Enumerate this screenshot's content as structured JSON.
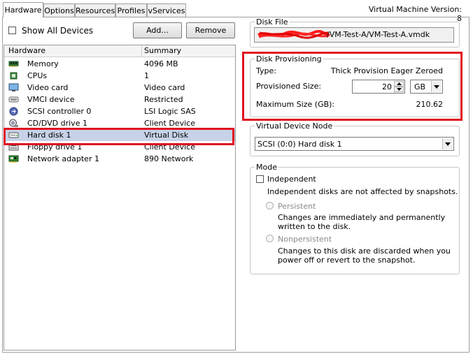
{
  "tabs": [
    {
      "label": "Hardware",
      "active": true
    },
    {
      "label": "Options",
      "active": false
    },
    {
      "label": "Resources",
      "active": false
    },
    {
      "label": "Profiles",
      "active": false
    },
    {
      "label": "vServices",
      "active": false
    }
  ],
  "vm_version": "Virtual Machine Version: 8",
  "toolbar": {
    "show_all_devices": "Show All Devices",
    "add_button": "Add...",
    "remove_button": "Remove"
  },
  "hardware_list": {
    "col_hardware": "Hardware",
    "col_summary": "Summary",
    "rows": [
      {
        "name": "Memory",
        "summary": "4096 MB",
        "icon": "memory-icon"
      },
      {
        "name": "CPUs",
        "summary": "1",
        "icon": "cpu-icon"
      },
      {
        "name": "Video card",
        "summary": "Video card",
        "icon": "monitor-icon"
      },
      {
        "name": "VMCI device",
        "summary": "Restricted",
        "icon": "vmci-icon"
      },
      {
        "name": "SCSI controller 0",
        "summary": "LSI Logic SAS",
        "icon": "scsi-icon"
      },
      {
        "name": "CD/DVD drive 1",
        "summary": "Client Device",
        "icon": "cd-icon"
      },
      {
        "name": "Hard disk 1",
        "summary": "Virtual Disk",
        "icon": "hard-disk-icon"
      },
      {
        "name": "Floppy drive 1",
        "summary": "Client Device",
        "icon": "floppy-icon"
      },
      {
        "name": "Network adapter 1",
        "summary": "890 Network",
        "icon": "network-adapter-icon"
      }
    ],
    "selected_index": 6
  },
  "disk_file": {
    "legend": "Disk File",
    "value": "/VM-Test-A/VM-Test-A.vmdk"
  },
  "disk_provisioning": {
    "legend": "Disk Provisioning",
    "type_label": "Type:",
    "type_value": "Thick Provision Eager Zeroed",
    "provisioned_label": "Provisioned Size:",
    "provisioned_value": "20",
    "unit": "GB",
    "max_label": "Maximum Size (GB):",
    "max_value": "210.62"
  },
  "virtual_device_node": {
    "legend": "Virtual Device Node",
    "selected": "SCSI (0:0) Hard disk 1"
  },
  "mode": {
    "legend": "Mode",
    "independent_label": "Independent",
    "independent_desc": "Independent disks are not affected by snapshots.",
    "persistent_label": "Persistent",
    "persistent_desc": "Changes are immediately and permanently written to the disk.",
    "nonpersistent_label": "Nonpersistent",
    "nonpersistent_desc": "Changes to this disk are discarded when you power off or revert to the snapshot."
  },
  "colors": {
    "highlight_red": "#e01020",
    "selection": "#c7d2e8",
    "redaction": "#ff1a1a"
  }
}
